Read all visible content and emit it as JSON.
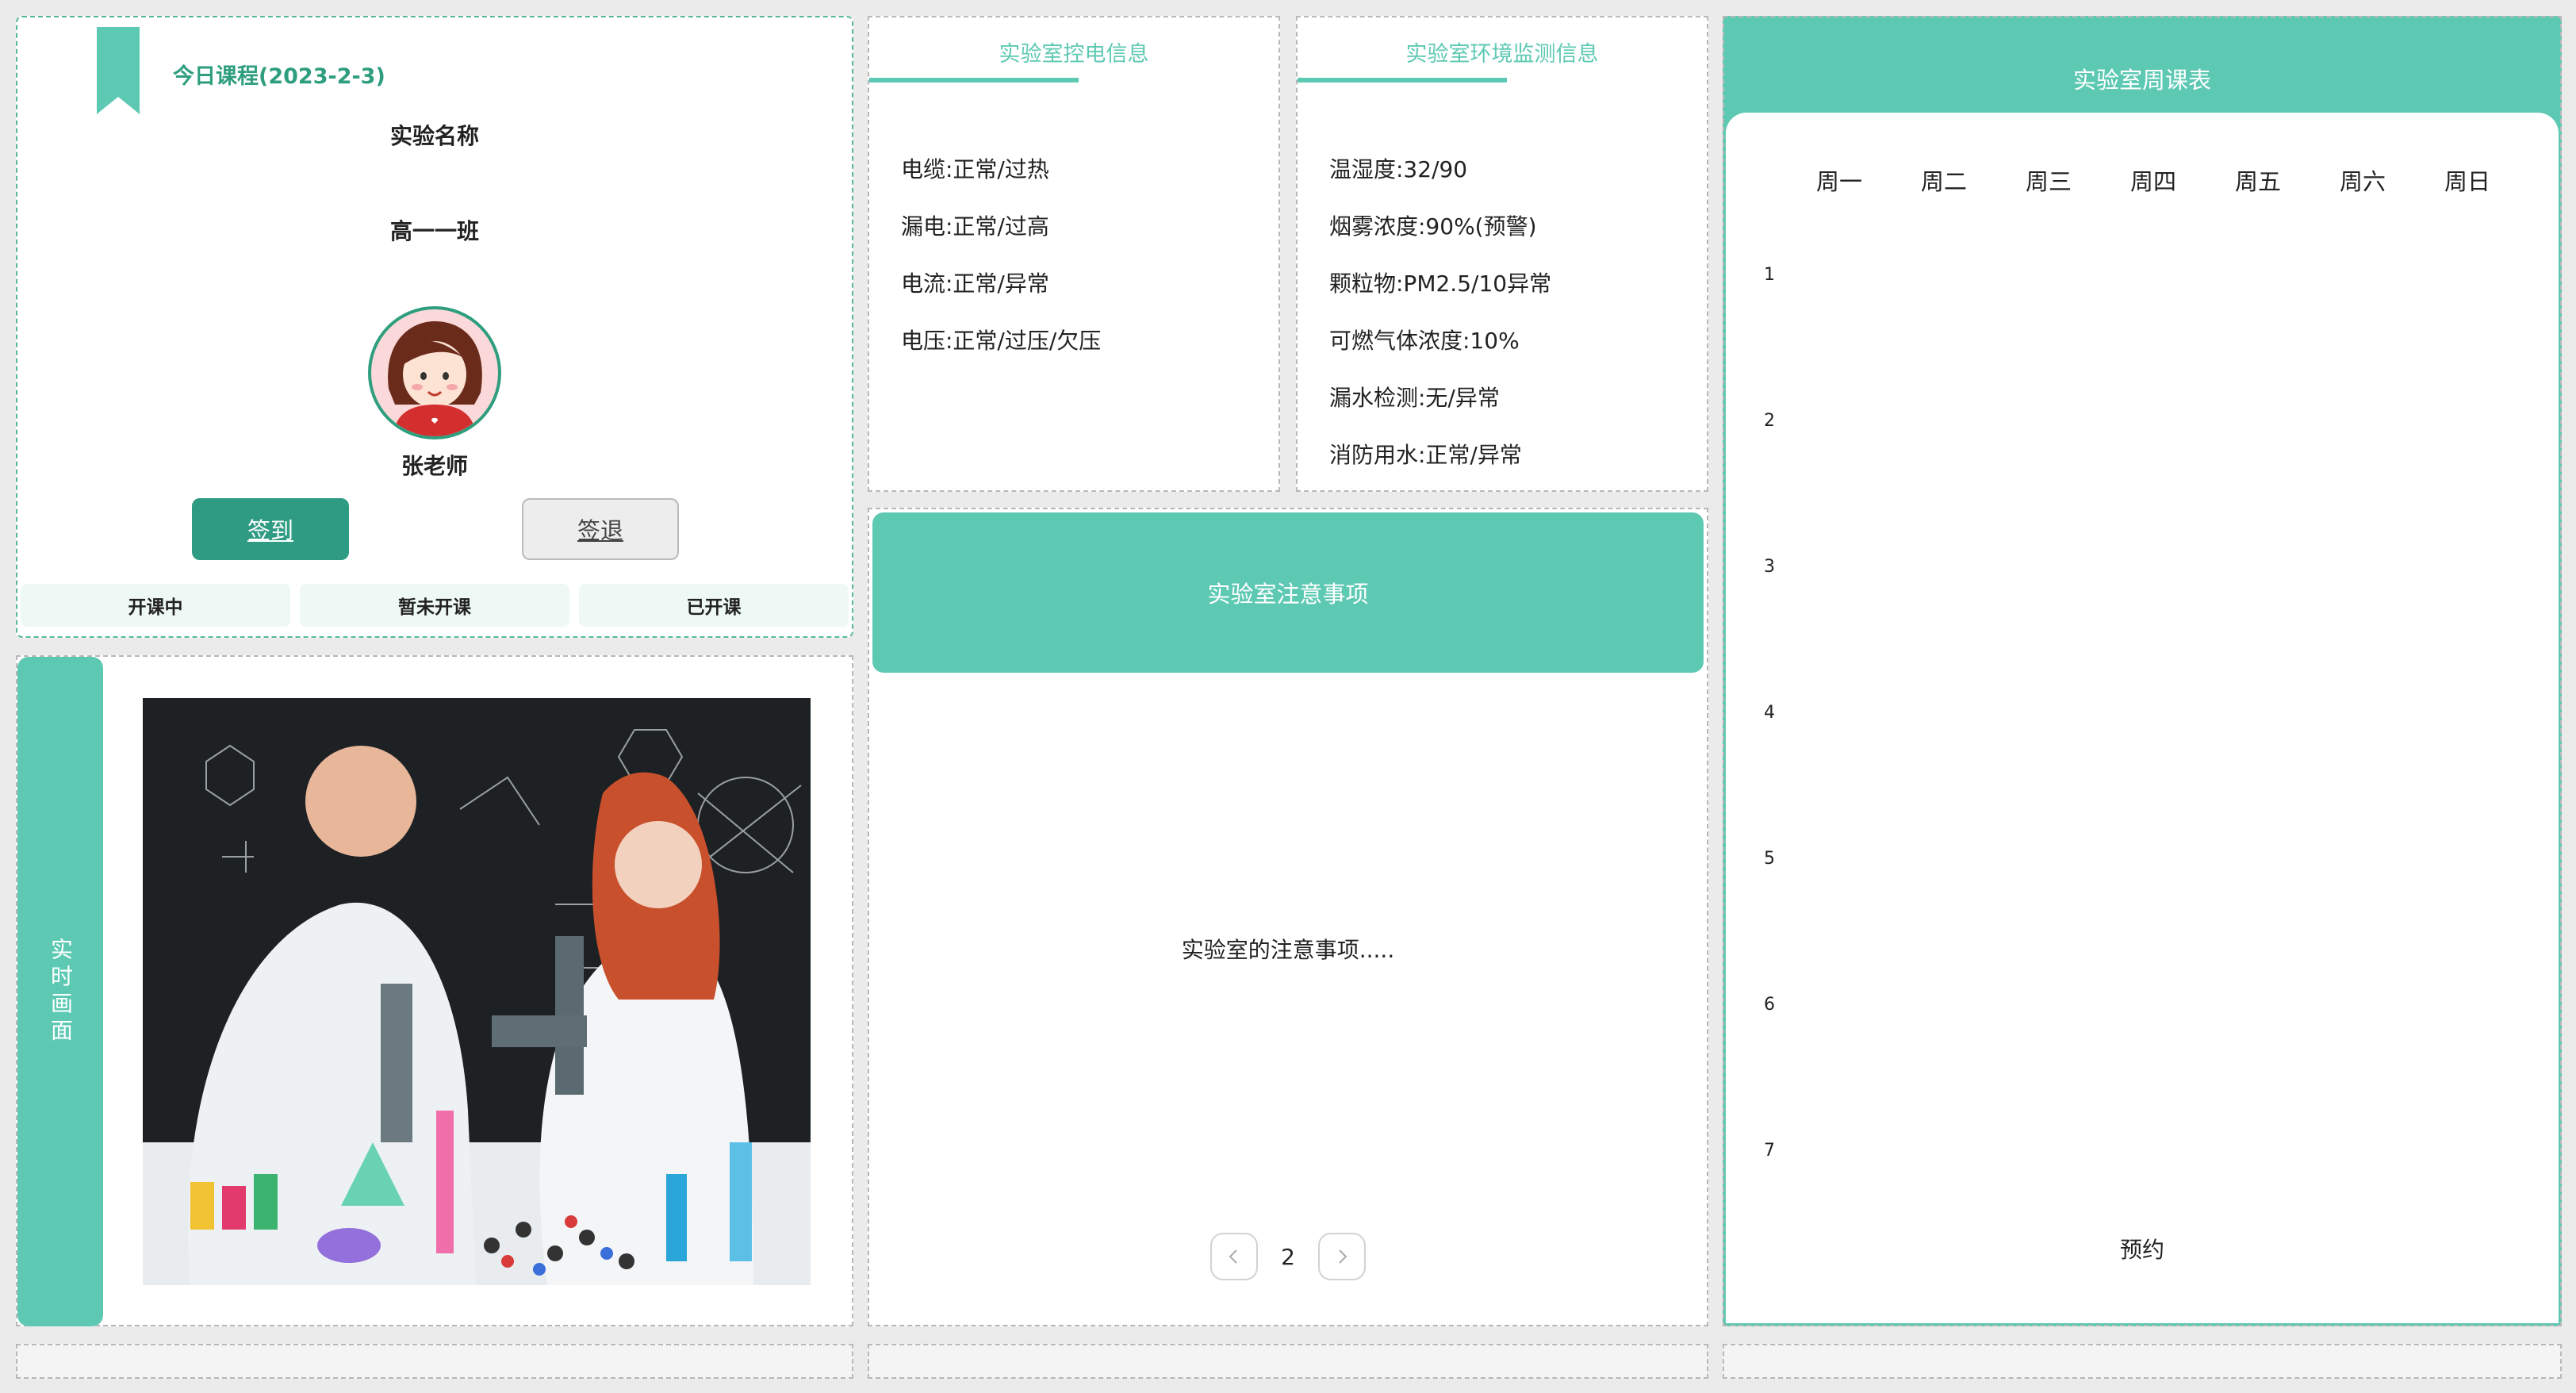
{
  "course": {
    "title": "今日课程(2023-2-3)",
    "experiment_name": "实验名称",
    "class_name": "高一一班",
    "teacher": "张老师",
    "checkin_label": "签到",
    "checkout_label": "签退",
    "statuses": [
      "开课中",
      "暂未开课",
      "已开课"
    ]
  },
  "power": {
    "title": "实验室控电信息",
    "items": [
      "电缆:正常/过热",
      "漏电:正常/过高",
      "电流:正常/异常",
      "电压:正常/过压/欠压"
    ]
  },
  "environment": {
    "title": "实验室环境监测信息",
    "items": [
      "温湿度:32/90",
      "烟雾浓度:90%(预警)",
      "颗粒物:PM2.5/10异常",
      "可燃气体浓度:10%",
      "漏水检测:无/异常",
      "消防用水:正常/异常"
    ]
  },
  "notes": {
    "title": "实验室注意事项",
    "text": "实验室的注意事项.....",
    "page": "2"
  },
  "schedule": {
    "title": "实验室周课表",
    "days": [
      "周一",
      "周二",
      "周三",
      "周四",
      "周五",
      "周六",
      "周日"
    ],
    "periods": [
      "1",
      "2",
      "3",
      "4",
      "5",
      "6",
      "7"
    ],
    "reserve_label": "预约"
  },
  "live": {
    "label": "实时画面"
  },
  "colors": {
    "accent": "#5ec9b3",
    "accent_dark": "#2e9b82"
  }
}
